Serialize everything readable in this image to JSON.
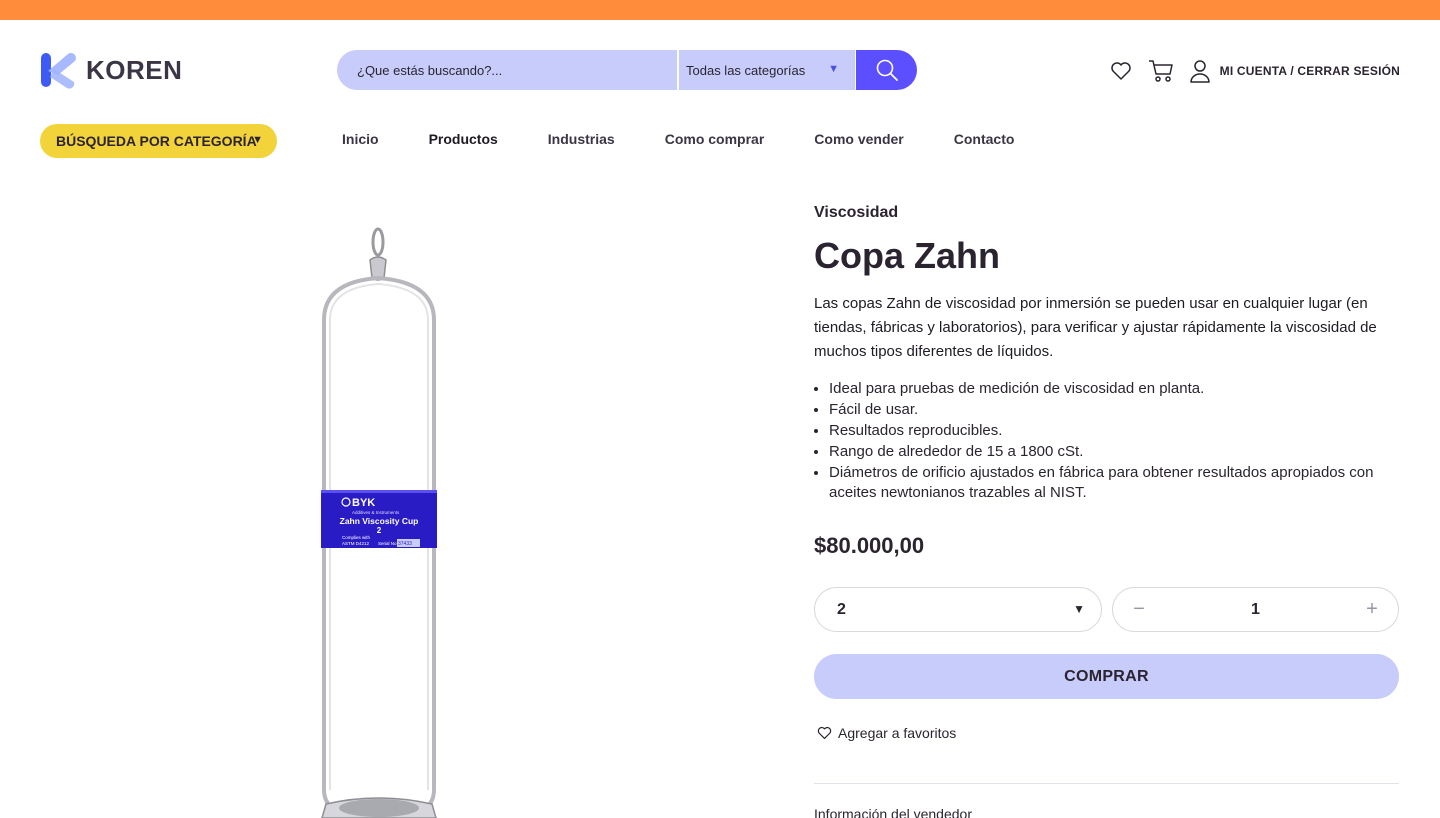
{
  "colors": {
    "top_strip": "#FF8C3B",
    "search_bg": "#C7CCFB",
    "search_button": "#5B4FFF",
    "category_button": "#F2D43A",
    "buy_button": "#C7CCFB",
    "logo_blue": "#3F5BF6",
    "logo_light": "#9FB3FF"
  },
  "brand": {
    "name": "KOREN",
    "logo_icon": "k-logo-icon"
  },
  "search": {
    "placeholder": "¿Que estás buscando?...",
    "category_value": "Todas las categorías",
    "button_icon": "search-icon"
  },
  "header": {
    "wishlist_icon": "heart-icon",
    "cart_icon": "cart-icon",
    "account_icon": "user-icon",
    "account_label": "MI CUENTA / CERRAR SESIÓN"
  },
  "nav": {
    "category_button": "BÚSQUEDA POR CATEGORÍA",
    "items": [
      {
        "label": "Inicio"
      },
      {
        "label": "Productos"
      },
      {
        "label": "Industrias"
      },
      {
        "label": "Como comprar"
      },
      {
        "label": "Como vender"
      },
      {
        "label": "Contacto"
      }
    ]
  },
  "product": {
    "image_label": {
      "brand": "BYK",
      "subtitle": "Additives & Instruments",
      "name": "Zahn Viscosity Cup",
      "size": "2",
      "compliance": "Complies with",
      "astm": "ASTM D4212",
      "serial_label": "Serial No.",
      "serial": "37433"
    },
    "category": "Viscosidad",
    "title": "Copa Zahn",
    "description": "Las copas Zahn de viscosidad por inmersión se pueden usar en cualquier lugar (en tiendas, fábricas y laboratorios), para verificar y ajustar rápidamente la viscosidad de muchos tipos diferentes de líquidos.",
    "features": [
      "Ideal para pruebas de medición de viscosidad en planta.",
      "Fácil de usar.",
      "Resultados reproducibles.",
      "Rango de alrededor de 15 a 1800 cSt.",
      "Diámetros de orificio ajustados en fábrica para obtener resultados apropiados con aceites newtonianos trazables al NIST."
    ],
    "price": "$80.000,00",
    "variant_value": "2",
    "quantity": "1",
    "qty_minus": "−",
    "qty_plus": "+",
    "buy_label": "COMPRAR",
    "favorite_label": "Agregar a favoritos",
    "seller_label": "Información del vendedor"
  }
}
